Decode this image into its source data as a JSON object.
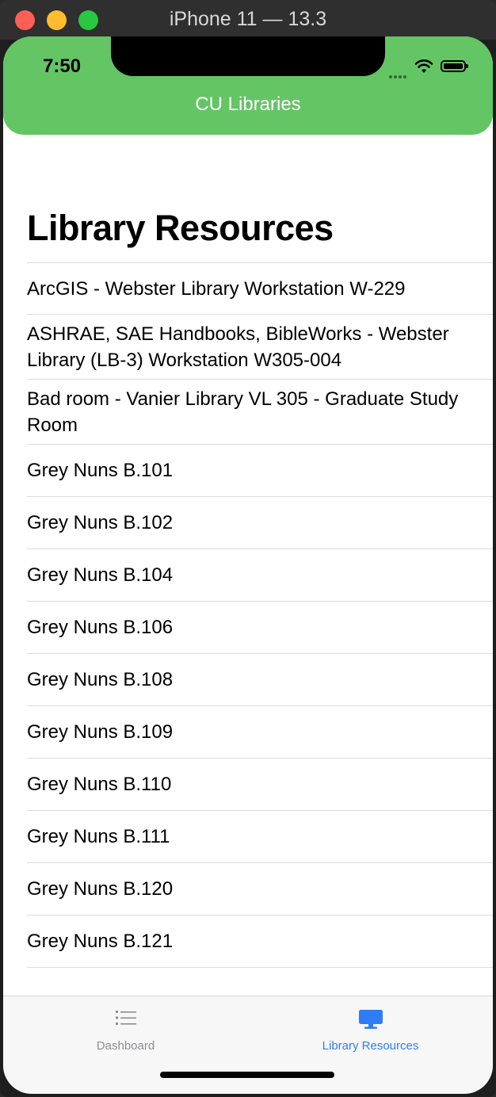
{
  "window": {
    "title": "iPhone 11 — 13.3"
  },
  "status_bar": {
    "time": "7:50"
  },
  "nav": {
    "title": "CU Libraries"
  },
  "page": {
    "title": "Library Resources"
  },
  "resources": [
    "ArcGIS - Webster Library Workstation W-229",
    "ASHRAE, SAE Handbooks, BibleWorks - Webster Library (LB-3) Workstation W305-004",
    "Bad room - Vanier Library VL 305 - Graduate Study Room",
    "Grey Nuns B.101",
    "Grey Nuns B.102",
    "Grey Nuns B.104",
    "Grey Nuns B.106",
    "Grey Nuns B.108",
    "Grey Nuns B.109",
    "Grey Nuns B.110",
    "Grey Nuns B.111",
    "Grey Nuns B.120",
    "Grey Nuns B.121"
  ],
  "tabs": [
    {
      "label": "Dashboard",
      "icon": "list-icon",
      "selected": false
    },
    {
      "label": "Library Resources",
      "icon": "desktop-icon",
      "selected": true
    }
  ],
  "colors": {
    "nav": "#64c565",
    "accent": "#2f7df6",
    "inactive": "#8e8e93"
  }
}
